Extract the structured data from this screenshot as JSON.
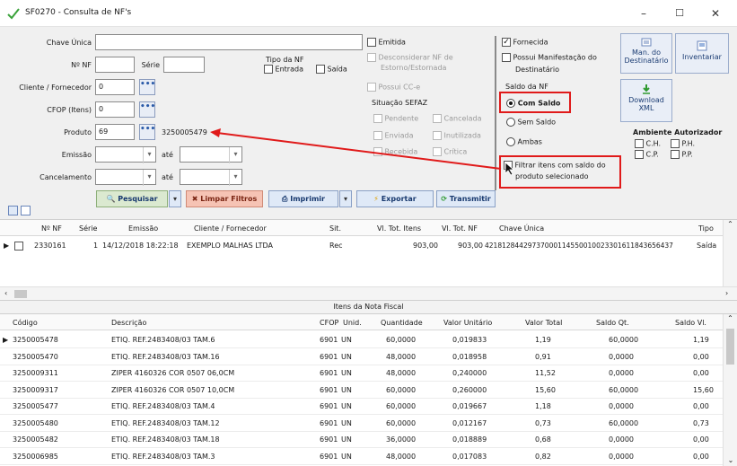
{
  "window": {
    "title": "SF0270 - Consulta de NF's",
    "min": "–",
    "max": "☐",
    "close": "✕"
  },
  "form": {
    "chave_unica_label": "Chave Única",
    "num_nf_label": "Nº NF",
    "serie_label": "Série",
    "cliente_label": "Cliente / Fornecedor",
    "cliente_value": "0",
    "cfop_label": "CFOP (Itens)",
    "cfop_value": "0",
    "produto_label": "Produto",
    "produto_value": "69",
    "produto_code": "3250005479",
    "emissao_label": "Emissão",
    "cancelamento_label": "Cancelamento",
    "ate_label": "até",
    "dots": "•••",
    "combo_arrow": "▾"
  },
  "tipo_nf": {
    "title": "Tipo da NF",
    "entrada": "Entrada",
    "saida": "Saída"
  },
  "emitida": {
    "emitida": "Emitida",
    "desconsiderar_1": "Desconsiderar NF de",
    "desconsiderar_2": "Estorno/Estornada",
    "possui_cce": "Possui CC-e"
  },
  "sefaz": {
    "title": "Situação SEFAZ",
    "pendente": "Pendente",
    "cancelada": "Cancelada",
    "enviada": "Enviada",
    "inutilizada": "Inutilizada",
    "recebida": "Recebida",
    "critica": "Crítica"
  },
  "right_panel": {
    "fornecida": "Fornecida",
    "manifestacao_1": "Possui Manifestação do",
    "manifestacao_2": "Destinatário",
    "saldo_title": "Saldo da NF",
    "com_saldo": "Com Saldo",
    "sem_saldo": "Sem Saldo",
    "ambas": "Ambas",
    "filtrar_1": "Filtrar itens com saldo do",
    "filtrar_2": "produto selecionado",
    "man_dest_1": "Man. do",
    "man_dest_2": "Destinatário",
    "inventariar": "Inventariar",
    "download_1": "Download",
    "download_2": "XML",
    "ambiente_title": "Ambiente Autorizador",
    "ch": "C.H.",
    "ph": "P.H.",
    "cp": "C.P.",
    "pp": "P.P."
  },
  "actions": {
    "pesquisar": "Pesquisar",
    "limpar": "Limpar Filtros",
    "imprimir": "Imprimir",
    "exportar": "Exportar",
    "transmitir": "Transmitir",
    "split": "▾"
  },
  "nf_grid": {
    "headers": [
      "Nº NF",
      "Série",
      "Emissão",
      "Cliente / Fornecedor",
      "Sit.",
      "Vl. Tot. Itens",
      "Vl. Tot. NF",
      "Chave Única",
      "Tipo"
    ],
    "rows": [
      [
        "2330161",
        "1",
        "14/12/2018 18:22:18",
        "EXEMPLO MALHAS LTDA",
        "Rec",
        "903,00",
        "903,00",
        "42181284429737000114550010023301611843656437",
        "Saída"
      ]
    ]
  },
  "itens_title": "Itens da Nota Fiscal",
  "itens_grid": {
    "headers": [
      "Código",
      "Descrição",
      "CFOP",
      "Unid.",
      "Quantidade",
      "Valor Unitário",
      "Valor Total",
      "Saldo Qt.",
      "Saldo Vl."
    ],
    "rows": [
      [
        "3250005478",
        "ETIQ. REF.2483408/03 TAM.6",
        "6901",
        "UN",
        "60,0000",
        "0,019833",
        "1,19",
        "60,0000",
        "1,19"
      ],
      [
        "3250005470",
        "ETIQ. REF.2483408/03 TAM.16",
        "6901",
        "UN",
        "48,0000",
        "0,018958",
        "0,91",
        "0,0000",
        "0,00"
      ],
      [
        "3250009311",
        "ZIPER 4160326 COR 0507 06,0CM",
        "6901",
        "UN",
        "48,0000",
        "0,240000",
        "11,52",
        "0,0000",
        "0,00"
      ],
      [
        "3250009317",
        "ZIPER 4160326 COR 0507 10,0CM",
        "6901",
        "UN",
        "60,0000",
        "0,260000",
        "15,60",
        "60,0000",
        "15,60"
      ],
      [
        "3250005477",
        "ETIQ. REF.2483408/03 TAM.4",
        "6901",
        "UN",
        "60,0000",
        "0,019667",
        "1,18",
        "0,0000",
        "0,00"
      ],
      [
        "3250005480",
        "ETIQ. REF.2483408/03 TAM.12",
        "6901",
        "UN",
        "60,0000",
        "0,012167",
        "0,73",
        "60,0000",
        "0,73"
      ],
      [
        "3250005482",
        "ETIQ. REF.2483408/03 TAM.18",
        "6901",
        "UN",
        "36,0000",
        "0,018889",
        "0,68",
        "0,0000",
        "0,00"
      ],
      [
        "3250006985",
        "ETIQ. REF.2483408/03 TAM.3",
        "6901",
        "UN",
        "48,0000",
        "0,017083",
        "0,82",
        "0,0000",
        "0,00"
      ]
    ]
  },
  "colors": {
    "highlight": "#e01a1a",
    "accent": "#2a5aa8"
  }
}
